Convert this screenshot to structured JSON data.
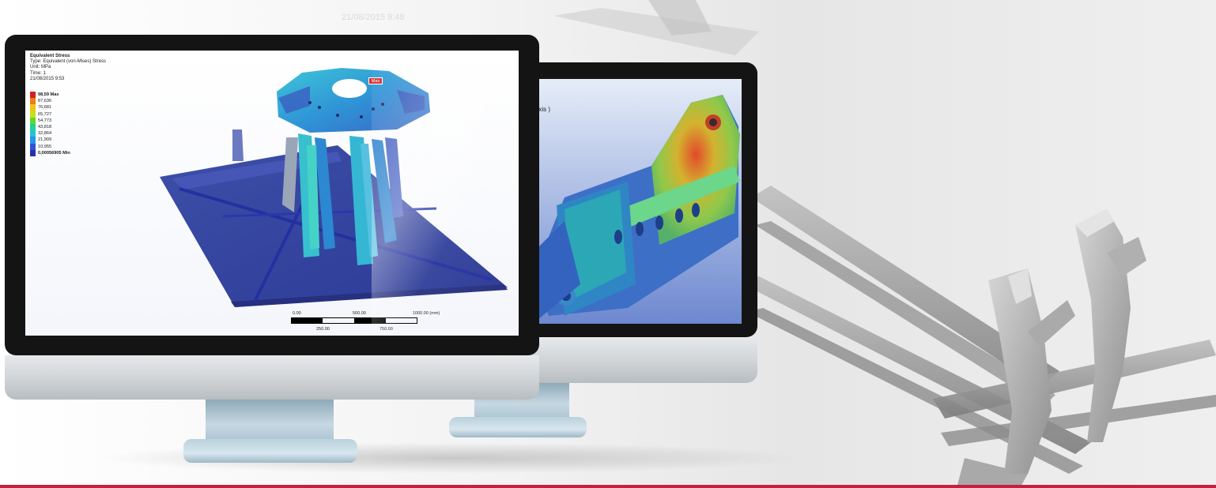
{
  "background": {
    "timestamp_label": "21/08/2015 9:48",
    "accent_line_color": "#c3223f"
  },
  "front_screen": {
    "info": {
      "title": "Equivalent Stress",
      "type": "Type: Equivalent (von-Mises) Stress",
      "unit": "Unit: MPa",
      "time": "Time: 1",
      "date": "21/08/2015 9:53"
    },
    "legend": [
      {
        "label": "98,59 Max",
        "color": "#d42020",
        "bold": true
      },
      {
        "label": "87,636",
        "color": "#ee7d16",
        "bold": false
      },
      {
        "label": "76,681",
        "color": "#f0c419",
        "bold": false
      },
      {
        "label": "65,727",
        "color": "#c6e11c",
        "bold": false
      },
      {
        "label": "54,773",
        "color": "#5fd92a",
        "bold": false
      },
      {
        "label": "43,818",
        "color": "#24d08f",
        "bold": false
      },
      {
        "label": "32,864",
        "color": "#22c3d8",
        "bold": false
      },
      {
        "label": "21,909",
        "color": "#2a93e6",
        "bold": false
      },
      {
        "label": "10,955",
        "color": "#2b55d3",
        "bold": false
      },
      {
        "label": "0,00056905 Min",
        "color": "#2a2ea8",
        "bold": true
      }
    ],
    "max_tag": "Max",
    "scale": {
      "top_labels": [
        "0.00",
        "500.00",
        "1000.00 (mm)"
      ],
      "bottom_labels": [
        "250.00",
        "750.00"
      ]
    }
  },
  "back_screen": {
    "axis_label": "Axis )"
  }
}
